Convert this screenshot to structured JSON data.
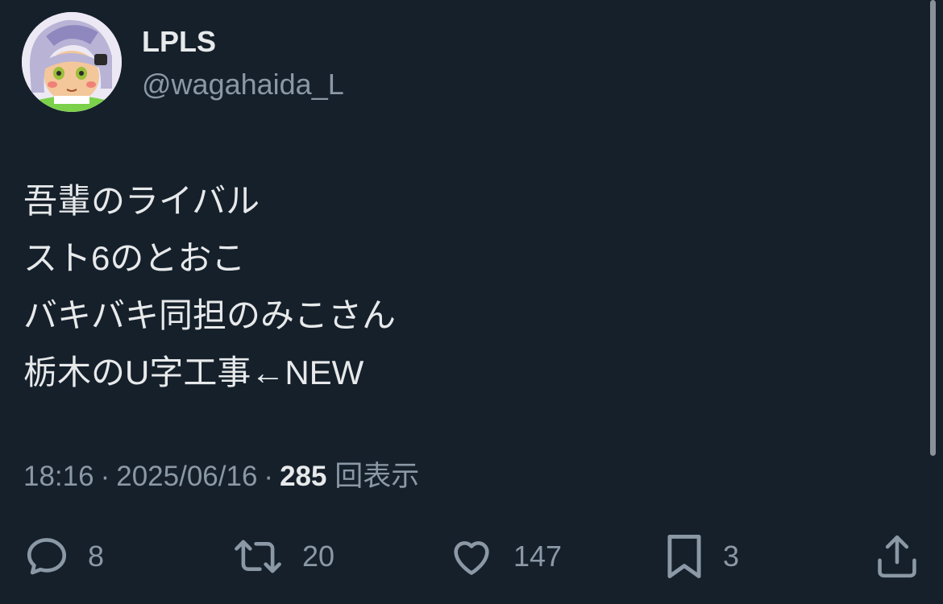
{
  "author": {
    "display_name": "LPLS",
    "handle": "@wagahaida_L",
    "avatar_icon": "avatar-image"
  },
  "tweet": {
    "lines": [
      "吾輩のライバル",
      "スト6のとおこ",
      "バキバキ同担のみこさん",
      "栃木のU字工事←NEW"
    ]
  },
  "meta": {
    "time": "18:16",
    "date": "2025/06/16",
    "separator": "·",
    "views_count": "285",
    "views_label": "回表示"
  },
  "actions": {
    "reply": {
      "icon": "reply-icon",
      "count": "8"
    },
    "retweet": {
      "icon": "retweet-icon",
      "count": "20"
    },
    "like": {
      "icon": "heart-icon",
      "count": "147"
    },
    "bookmark": {
      "icon": "bookmark-icon",
      "count": "3"
    },
    "share": {
      "icon": "share-icon"
    }
  },
  "colors": {
    "background": "#15202b",
    "primary_text": "#e7e9ea",
    "secondary_text": "#8b98a5"
  }
}
